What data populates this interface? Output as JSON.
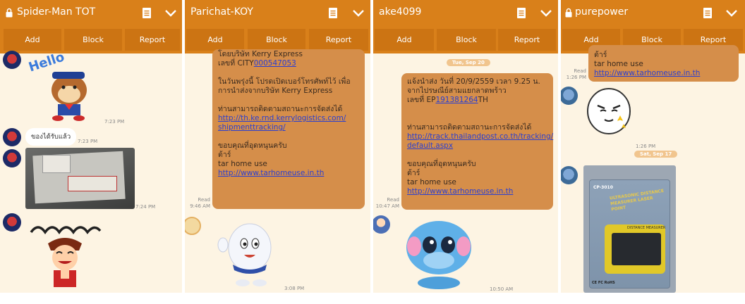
{
  "buttons": {
    "add": "Add",
    "block": "Block",
    "report": "Report"
  },
  "panels": [
    {
      "title": "Spider-Man TOT",
      "messages": {
        "hello_sticker_text": "Hello",
        "time_1": "7:23 PM",
        "received_text": "ของได้รับแล้ว",
        "time_2": "7:23 PM",
        "time_3": "7:24 PM"
      }
    },
    {
      "title": "Parichat-KOY",
      "messages": {
        "line1": "โดยบริษัท Kerry Express",
        "line2_prefix": "เลขที่ CITY",
        "line2_link": "000547053",
        "para2_l1": "ในวันพรุ่งนี้ โปรดเปิดเบอร์โทรศัพท์ไว้ เพื่อ",
        "para2_l2": "การนำส่งจากบริษัท Kerry Express",
        "para3_l1": "ท่านสามารถติดตามสถานะการจัดส่งได้",
        "para3_link1": "http://th.ke.rnd.kerrylogistics.com/",
        "para3_link2": "shipmenttracking/",
        "para4_l1": "ขอบคุณที่อุดหนุนครับ",
        "para4_l2": "ต้าร์",
        "para4_l3": "tar home use",
        "para4_link": "http://www.tarhomeuse.in.th",
        "read": "Read",
        "read_time": "9:46 AM",
        "time_bottom": "3:08 PM"
      }
    },
    {
      "title": "ake4099",
      "messages": {
        "date_pill": "Tue, Sep 20",
        "line1": "แจ้งนำส่ง วันที่ 20/9/2559 เวลา  9.25 น.",
        "line2": "จากไปรษณีย์สามแยกลาดพร้าว",
        "line3_prefix": "เลขที่ EP",
        "line3_link": "191381264",
        "line3_suffix": "TH",
        "para2_l1": "ท่านสามารถติดตามสถานะการจัดส่งได้",
        "para2_link1": "http://track.thailandpost.co.th/tracking/",
        "para2_link2": "default.aspx",
        "para3_l1": "ขอบคุณที่อุดหนุนครับ",
        "para3_l2": "ต้าร์",
        "para3_l3": "tar home use",
        "para3_link": "http://www.tarhomeuse.in.th",
        "read": "Read",
        "read_time": "10:47 AM",
        "time_bottom": "10:50 AM"
      }
    },
    {
      "title": "purepower",
      "messages": {
        "line1": "ต้าร์",
        "line2": "tar home use",
        "link": "http://www.tarhomeuse.in.th",
        "read": "Read",
        "read_time": "1:26 PM",
        "time_sticker": "1:26 PM",
        "date_pill": "Sat, Sep 17",
        "device_model": "CP-3010",
        "device_text": "ULTRASONIC DISTANCE MEASURER LASER POINT",
        "device_sub": "DISTANCE MEASURER",
        "device_marks": "CE FC RoHS"
      }
    }
  ],
  "colors": {
    "header": "#d9801a",
    "button": "#cc7413",
    "bubble": "#d58e4a",
    "chat_bg": "#fdf4e3",
    "link": "#2a3fd1"
  },
  "icons": [
    "lock-icon",
    "note-icon",
    "chevron-down-icon"
  ]
}
